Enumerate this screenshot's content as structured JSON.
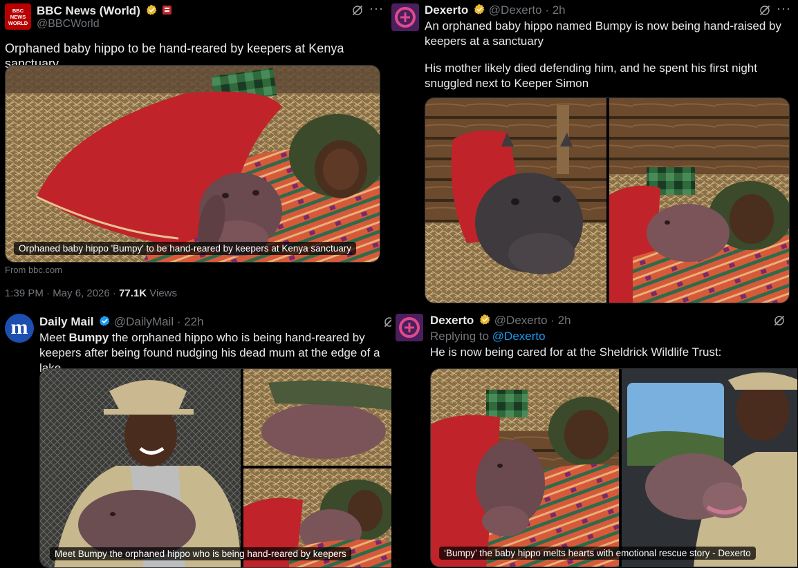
{
  "colors": {
    "background": "#000000",
    "text": "#e7e9ea",
    "muted": "#71767b",
    "link": "#1d9bf0",
    "verified_gold": "#e8b830",
    "verified_blue": "#1d9bf0"
  },
  "posts": [
    {
      "author": "BBC News (World)",
      "avatar_text": "BBC NEWS WORLD",
      "handle": "@BBCWorld",
      "text": "Orphaned baby hippo to be hand-reared by keepers at Kenya sanctuary",
      "image_caption": "Orphaned baby hippo 'Bumpy' to be hand-reared by keepers at Kenya sanctuary",
      "source": "From bbc.com",
      "time": "1:39 PM · May 6, 2026 · ",
      "views_count": "77.1K",
      "views_label": " Views",
      "icons": [
        "verified-gold-icon",
        "flag-icon",
        "grok-icon",
        "more-icon"
      ]
    },
    {
      "author": "Dexerto",
      "handle": "@Dexerto",
      "time": "· 2h",
      "text_line1": "An orphaned baby hippo named Bumpy is now being hand-raised by keepers at a sanctuary",
      "text_line2": "His mother likely died defending him, and he spent his first night snuggled next to Keeper Simon",
      "icons": [
        "verified-gold-icon",
        "grok-icon",
        "more-icon"
      ]
    },
    {
      "author": "Daily Mail",
      "avatar_text": "m",
      "handle": "@DailyMail",
      "time": "· 22h",
      "text_pre": "Meet ",
      "text_bold": "Bumpy",
      "text_post": " the orphaned hippo who is being hand-reared by keepers after being found nudging his dead mum at the edge of a lake",
      "image_caption": "Meet Bumpy the orphaned hippo who is being hand-reared by keepers",
      "icons": [
        "verified-blue-icon",
        "grok-icon"
      ]
    },
    {
      "author": "Dexerto",
      "handle": "@Dexerto",
      "time": "· 2h",
      "reply_prefix": "Replying to ",
      "reply_to": "@Dexerto",
      "text": "He is now being cared for at the Sheldrick Wildlife Trust:",
      "image_caption": "‘Bumpy’ the baby hippo melts hearts with emotional rescue story - Dexerto",
      "icons": [
        "verified-gold-icon",
        "grok-icon"
      ]
    }
  ]
}
